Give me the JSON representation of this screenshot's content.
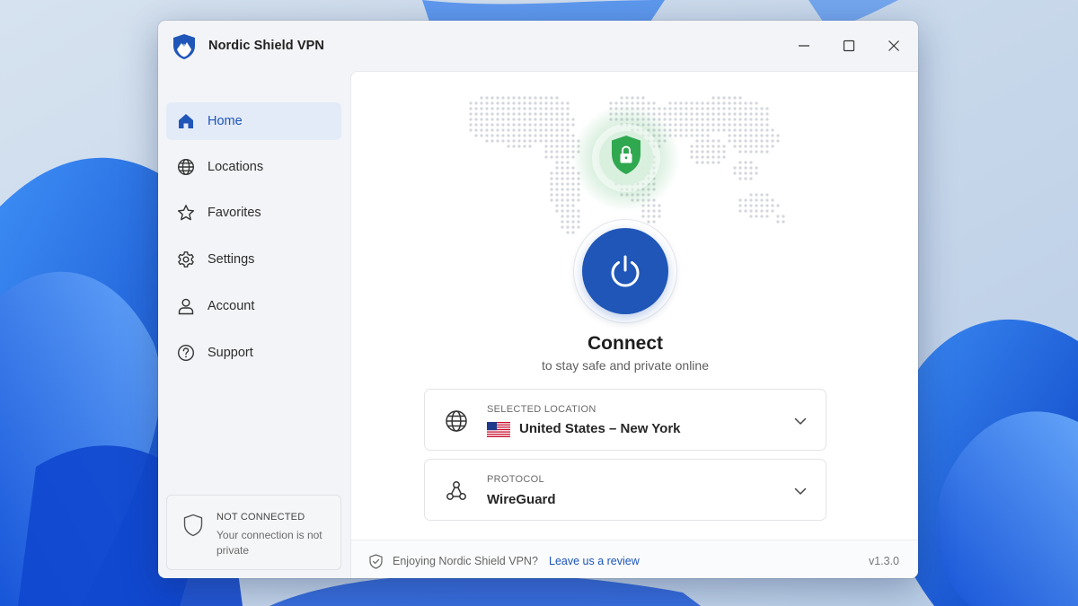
{
  "app": {
    "title": "Nordic Shield VPN"
  },
  "window_controls": [
    "minimize-icon",
    "maximize-icon",
    "close-icon"
  ],
  "sidebar": {
    "items": [
      {
        "label": "Home",
        "icon": "home-icon",
        "active": true
      },
      {
        "label": "Locations",
        "icon": "globe-icon",
        "active": false
      },
      {
        "label": "Favorites",
        "icon": "star-icon",
        "active": false
      },
      {
        "label": "Settings",
        "icon": "gear-icon",
        "active": false
      },
      {
        "label": "Account",
        "icon": "user-icon",
        "active": false
      },
      {
        "label": "Support",
        "icon": "help-icon",
        "active": false
      }
    ],
    "status": {
      "title": "NOT CONNECTED",
      "description": "Your connection is not private",
      "icon": "shield-outline-icon"
    }
  },
  "main": {
    "connect_title": "Connect",
    "connect_subtitle": "to stay safe and private online",
    "location": {
      "caption": "SELECTED LOCATION",
      "value": "United States – New York",
      "flag": "us-flag-icon"
    },
    "protocol": {
      "caption": "PROTOCOL",
      "value": "WireGuard"
    }
  },
  "footer": {
    "text": "Enjoying Nordic Shield VPN?",
    "link": "Leave us a review",
    "version": "v1.3.0"
  },
  "colors": {
    "accent": "#1f56b8",
    "shield_green": "#2fa84f",
    "active_nav_bg": "#e4ebf8"
  }
}
